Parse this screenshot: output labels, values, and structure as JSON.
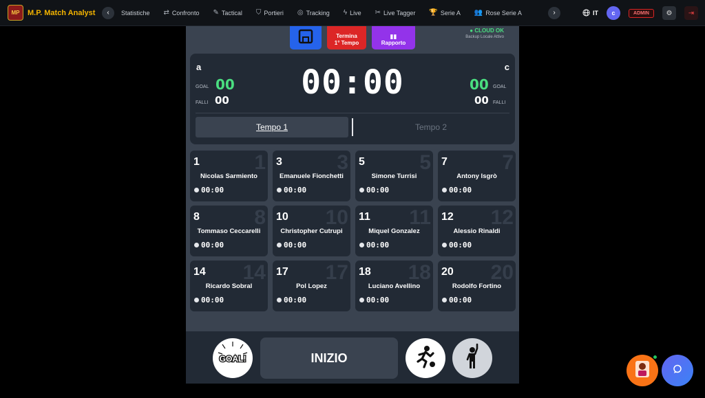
{
  "app": {
    "title": "M.P. Match Analyst",
    "logo_text": "MP"
  },
  "nav": {
    "items": [
      {
        "label": "Statistiche",
        "icon": ""
      },
      {
        "label": "Confronto",
        "icon": "⇄"
      },
      {
        "label": "Tactical",
        "icon": "✎"
      },
      {
        "label": "Portieri",
        "icon": "⛉"
      },
      {
        "label": "Tracking",
        "icon": "◎"
      },
      {
        "label": "Live",
        "icon": "ϟ"
      },
      {
        "label": "Live Tagger",
        "icon": "✂"
      },
      {
        "label": "Serie A",
        "icon": "🏆"
      },
      {
        "label": "Rose Serie A",
        "icon": "👥"
      }
    ]
  },
  "header": {
    "language": "IT",
    "user_initial": "c",
    "role_badge": "ADMIN"
  },
  "actions": {
    "end_half_line1": "Termina",
    "end_half_line2": "1° Tempo",
    "report": "Rapporto"
  },
  "cloud": {
    "status": "● CLOUD OK",
    "subtitle": "Backup Locale Attivo"
  },
  "scoreboard": {
    "team_home": "a",
    "team_away": "c",
    "goal_label": "GOAL",
    "foul_label": "FALLI",
    "home_goals": "00",
    "home_fouls": "00",
    "away_goals": "00",
    "away_fouls": "00",
    "timer": "00:00",
    "half_1": "Tempo 1",
    "half_2": "Tempo 2"
  },
  "players": [
    {
      "number": "1",
      "name": "Nicolas Sarmiento",
      "time": "00:00"
    },
    {
      "number": "3",
      "name": "Emanuele Fionchetti",
      "time": "00:00"
    },
    {
      "number": "5",
      "name": "Simone Turrisi",
      "time": "00:00"
    },
    {
      "number": "7",
      "name": "Antony Isgrò",
      "time": "00:00"
    },
    {
      "number": "8",
      "name": "Tommaso Ceccarelli",
      "time": "00:00"
    },
    {
      "number": "10",
      "name": "Christopher Cutrupi",
      "time": "00:00"
    },
    {
      "number": "11",
      "name": "Miquel Gonzalez",
      "time": "00:00"
    },
    {
      "number": "12",
      "name": "Alessio Rinaldi",
      "time": "00:00"
    },
    {
      "number": "14",
      "name": "Ricardo Sobral",
      "time": "00:00"
    },
    {
      "number": "17",
      "name": "Pol Lopez",
      "time": "00:00"
    },
    {
      "number": "18",
      "name": "Luciano Avellino",
      "time": "00:00"
    },
    {
      "number": "20",
      "name": "Rodolfo Fortino",
      "time": "00:00"
    }
  ],
  "controls": {
    "start": "INIZIO",
    "goal_icon_text": "GOAL!"
  },
  "colors": {
    "brand": "#f4b400",
    "goal": "#4ade80",
    "end_half": "#dc2626",
    "report": "#9333ea",
    "save": "#2563eb"
  }
}
